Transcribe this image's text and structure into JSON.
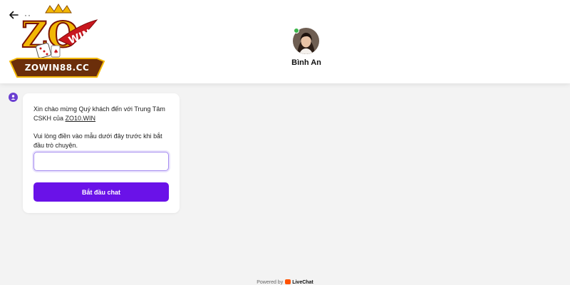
{
  "header": {
    "back_icon": "arrow-left-icon",
    "menu_dots": "··",
    "logo": {
      "main_text": "ZO",
      "sub_text": "WIN",
      "banner_text": "ZOWIN88.CC",
      "colors": {
        "gold": "#f2b705",
        "red": "#c8171e",
        "brown": "#6b2e0a"
      }
    },
    "agent": {
      "name": "Bình An",
      "avatar_icon": "agent-avatar",
      "online_color": "#3bb54a"
    }
  },
  "chat": {
    "bot_icon": "user-icon",
    "bot_icon_color": "#6b3fd1",
    "welcome_text": "Xin chào mừng Quý khách đến với Trung Tâm CSKH của ",
    "welcome_link": "ZO10.WIN",
    "form_prompt": "Vui lòng điền vào mẫu dưới đây trước khi bắt đầu trò chuyện.",
    "input_value": "",
    "input_placeholder": "",
    "start_button_label": "Bắt đầu chat",
    "accent_color": "#6a12e8"
  },
  "footer": {
    "powered_by": "Powered by",
    "brand": "LiveChat",
    "brand_color": "#ff5100"
  }
}
